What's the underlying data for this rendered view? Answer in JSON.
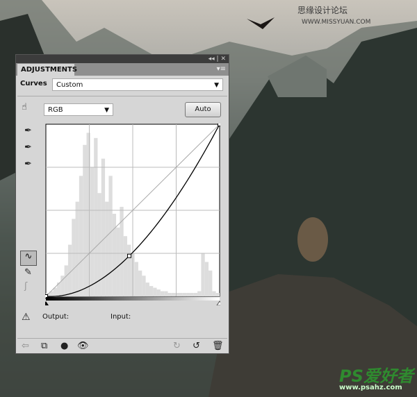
{
  "watermark": {
    "text": "思缘设计论坛",
    "url": "WWW.MISSYUAN.COM"
  },
  "logo": {
    "brand": "PS爱好者",
    "url": "www.psahz.com"
  },
  "panel": {
    "window_controls": "◂◂ | ✕",
    "tab": "ADJUSTMENTS",
    "menu_icon": "▾≡",
    "preset_label": "Curves",
    "preset_value": "Custom",
    "channel_value": "RGB",
    "auto_label": "Auto",
    "output_label": "Output:",
    "input_label": "Input:",
    "curve_points": [
      [
        0,
        0
      ],
      [
        0.48,
        0.235
      ],
      [
        1,
        1
      ]
    ],
    "histogram": [
      2,
      3,
      5,
      8,
      12,
      18,
      30,
      45,
      55,
      70,
      88,
      95,
      75,
      92,
      60,
      80,
      55,
      70,
      48,
      40,
      52,
      35,
      30,
      25,
      20,
      15,
      12,
      8,
      6,
      5,
      4,
      3,
      3,
      2,
      2,
      2,
      2,
      2,
      2,
      2,
      2,
      3,
      25,
      20,
      15,
      3,
      2
    ]
  }
}
